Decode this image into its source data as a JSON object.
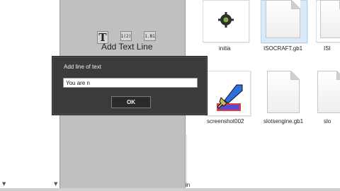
{
  "editor": {
    "caption": "Add Text Line",
    "tools": {
      "text_glyph": "T",
      "number_glyph": "1(2)",
      "abc_glyph": "1.B1"
    }
  },
  "dialog": {
    "title": "Add line of text",
    "input_value": "You are n",
    "ok_label": "OK"
  },
  "files": [
    {
      "name": "initia"
    },
    {
      "name": "ISOCRAFT.gb1"
    },
    {
      "name": "ISI"
    },
    {
      "name": "screenshot002"
    },
    {
      "name": "slotsengine.gb1"
    },
    {
      "name": "slo"
    }
  ],
  "bottom_label": "in",
  "colors": {
    "panel": "#c0c0c0",
    "dialog": "#3b3b3b",
    "selection": "#dce9f7"
  }
}
